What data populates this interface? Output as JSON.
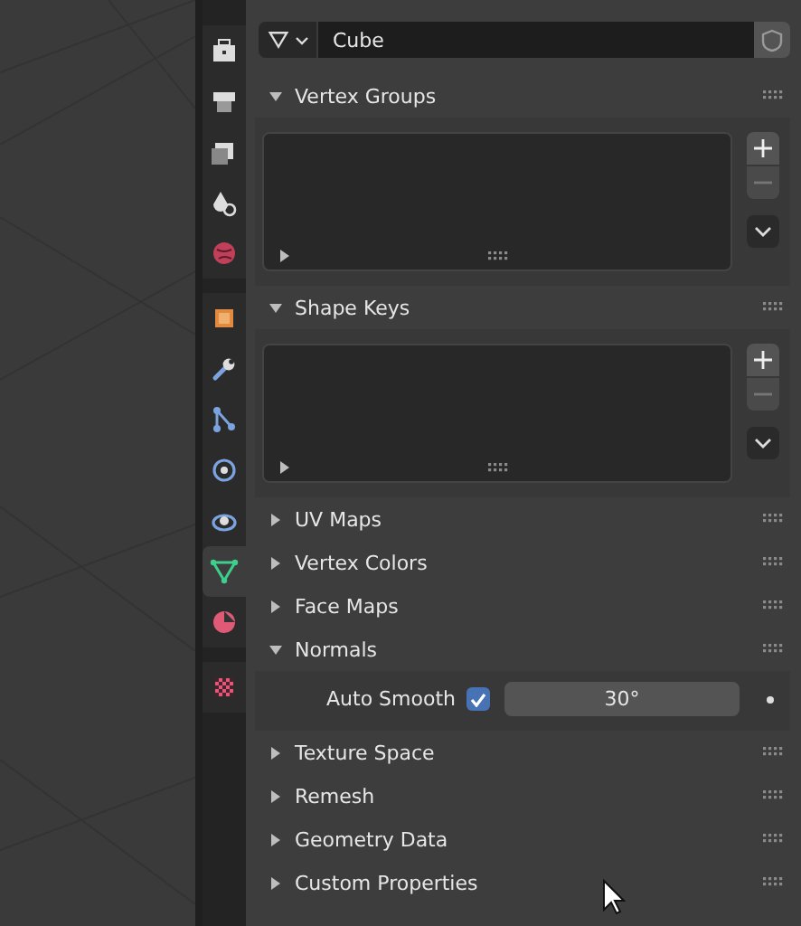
{
  "tab_groups": [
    {
      "tabs": [
        {
          "kind": "tool",
          "selected": false
        },
        {
          "kind": "render",
          "selected": false
        },
        {
          "kind": "output",
          "selected": false
        },
        {
          "kind": "scene",
          "selected": false
        },
        {
          "kind": "world",
          "selected": false
        }
      ]
    },
    {
      "tabs": [
        {
          "kind": "object",
          "selected": false
        },
        {
          "kind": "modifier",
          "selected": false
        },
        {
          "kind": "particles",
          "selected": false
        },
        {
          "kind": "physics",
          "selected": false
        },
        {
          "kind": "constraints",
          "selected": false
        },
        {
          "kind": "data",
          "selected": true
        },
        {
          "kind": "material",
          "selected": false
        }
      ]
    },
    {
      "tabs": [
        {
          "kind": "texture",
          "selected": false
        }
      ]
    }
  ],
  "data_block": {
    "name": "Cube"
  },
  "panels": [
    {
      "title": "Vertex Groups",
      "expanded": true,
      "kind": "list"
    },
    {
      "title": "Shape Keys",
      "expanded": true,
      "kind": "list"
    },
    {
      "title": "UV Maps",
      "expanded": false
    },
    {
      "title": "Vertex Colors",
      "expanded": false
    },
    {
      "title": "Face Maps",
      "expanded": false
    },
    {
      "title": "Normals",
      "expanded": true,
      "kind": "normals",
      "label": "Auto Smooth",
      "checked": true,
      "value": "30°"
    },
    {
      "title": "Texture Space",
      "expanded": false
    },
    {
      "title": "Remesh",
      "expanded": false
    },
    {
      "title": "Geometry Data",
      "expanded": false
    },
    {
      "title": "Custom Properties",
      "expanded": false
    }
  ]
}
